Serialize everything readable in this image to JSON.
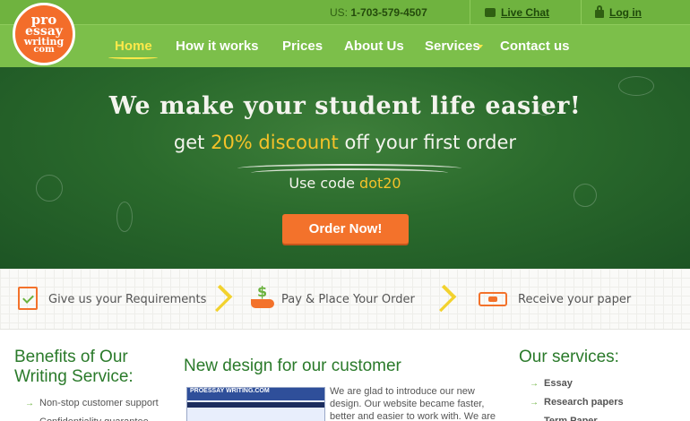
{
  "logo": {
    "line1": "pro",
    "line2": "essay",
    "line3": "writing",
    "line4": "com"
  },
  "topbar": {
    "phone_prefix": "US:",
    "phone": "1-703-579-4507",
    "live_chat": "Live Chat",
    "login": "Log in"
  },
  "nav": {
    "items": [
      {
        "label": "Home",
        "active": true
      },
      {
        "label": "How it works"
      },
      {
        "label": "Prices"
      },
      {
        "label": "About Us"
      },
      {
        "label": "Services"
      },
      {
        "label": "Contact us"
      }
    ]
  },
  "hero": {
    "title": "We make your student life easier!",
    "sub_pre": "get ",
    "sub_hl": "20% discount",
    "sub_post": " off your first order",
    "code_pre": "Use code ",
    "code_hl": "dot20",
    "button": "Order Now!"
  },
  "steps": [
    {
      "label": "Give us your Requirements"
    },
    {
      "label": "Pay & Place Your Order"
    },
    {
      "label": "Receive your paper"
    }
  ],
  "benefits": {
    "title": "Benefits of Our Writing Service:",
    "items": [
      "Non-stop customer support",
      "Confidentiality guarantee"
    ]
  },
  "news": {
    "title": "New design for our customer",
    "thumb_text": "PROESSAY WRITING.COM",
    "text": "We are glad to introduce our new design. Our website became faster, better and easier to work with. We are thankful for"
  },
  "services": {
    "title": "Our services:",
    "items": [
      "Essay",
      "Research papers",
      "Term Paper"
    ]
  },
  "colors": {
    "green": "#7cbf4a",
    "orange": "#f3722b",
    "chalkboard": "#2a6a2c",
    "yellow": "#f5c229"
  }
}
